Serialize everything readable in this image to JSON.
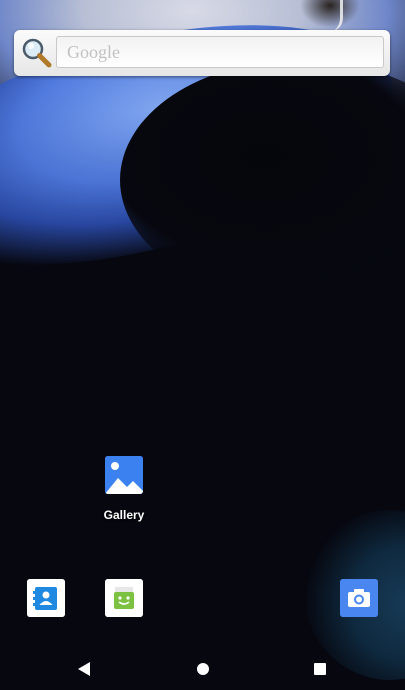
{
  "search_widget": {
    "placeholder": "Google"
  },
  "workspace": {
    "apps": [
      {
        "label": "Gallery",
        "icon": "gallery-icon"
      }
    ]
  },
  "hotseat": {
    "apps": [
      {
        "icon": "contacts-icon"
      },
      {
        "icon": "app-store-robot-icon"
      },
      {
        "icon": "camera-icon"
      }
    ]
  },
  "nav_bar": {
    "buttons": [
      "back",
      "home",
      "recents"
    ]
  },
  "colors": {
    "gallery_blue": "#3b82f0",
    "contacts_blue": "#1f88e0",
    "robot_green": "#7cc142",
    "camera_blue": "#4a86f0"
  }
}
